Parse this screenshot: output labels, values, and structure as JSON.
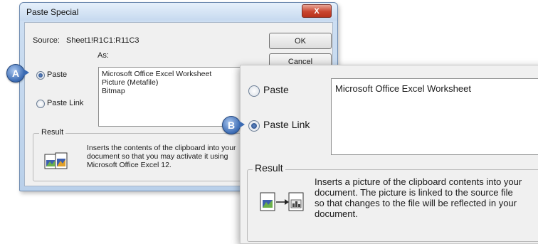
{
  "dialog": {
    "title": "Paste Special",
    "close_label": "X",
    "source_label": "Source:",
    "source_value": "Sheet1!R1C1:R11C3",
    "as_label": "As:",
    "ok_label": "OK",
    "cancel_label": "Cancel",
    "paste_label": "Paste",
    "paste_link_label": "Paste Link",
    "as_list": [
      "Microsoft Office Excel Worksheet",
      "Picture (Metafile)",
      "Bitmap"
    ],
    "result_label": "Result",
    "result_lines": [
      "Inserts the contents of the clipboard into your",
      "document so that you may activate it using",
      "Microsoft Office Excel 12."
    ]
  },
  "zoom": {
    "paste_label": "Paste",
    "paste_link_label": "Paste Link",
    "as_list": [
      "Microsoft Office Excel Worksheet"
    ],
    "result_label": "Result",
    "result_lines": [
      "Inserts a picture of the clipboard contents into your",
      "document.  The picture is linked to the source file",
      "so that changes to the file will be reflected in your",
      "document."
    ]
  },
  "callouts": {
    "a": "A",
    "b": "B"
  },
  "icons": {
    "close": "close-icon",
    "paste_result": "embedded-document-icon",
    "link_result": "linked-picture-icon"
  }
}
